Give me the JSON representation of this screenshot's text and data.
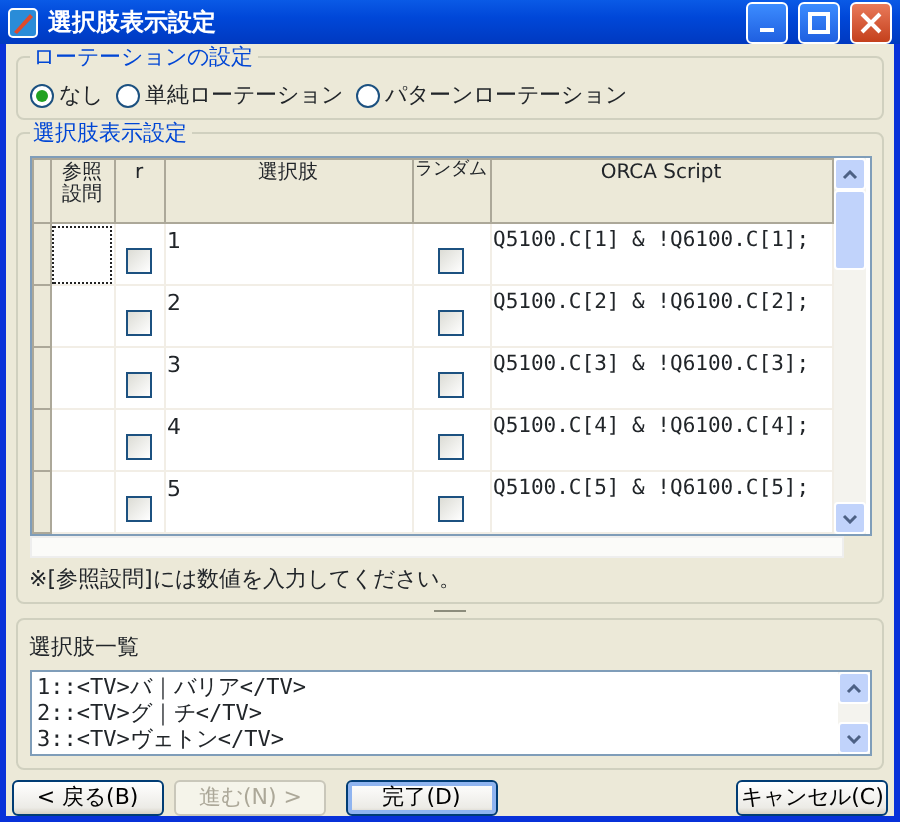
{
  "window": {
    "title": "選択肢表示設定"
  },
  "rotation": {
    "label": "ローテーションの設定",
    "options": [
      {
        "label": "なし",
        "selected": true
      },
      {
        "label": "単純ローテーション",
        "selected": false
      },
      {
        "label": "パターンローテーション",
        "selected": false
      }
    ]
  },
  "choices": {
    "label": "選択肢表示設定",
    "columns": [
      "参照設問",
      "r",
      "選択肢",
      "ランダム",
      "ORCA Script"
    ],
    "rows": [
      {
        "reference": "",
        "focused": true,
        "r_checked": false,
        "text": "1",
        "random_checked": false,
        "script": "Q5100.C[1] & !Q6100.C[1];"
      },
      {
        "reference": "",
        "focused": false,
        "r_checked": false,
        "text": "2",
        "random_checked": false,
        "script": "Q5100.C[2] & !Q6100.C[2];"
      },
      {
        "reference": "",
        "focused": false,
        "r_checked": false,
        "text": "3",
        "random_checked": false,
        "script": "Q5100.C[3] & !Q6100.C[3];"
      },
      {
        "reference": "",
        "focused": false,
        "r_checked": false,
        "text": "4",
        "random_checked": false,
        "script": "Q5100.C[4] & !Q6100.C[4];"
      },
      {
        "reference": "",
        "focused": false,
        "r_checked": false,
        "text": "5",
        "random_checked": false,
        "script": "Q5100.C[5] & !Q6100.C[5];"
      }
    ],
    "note": "※[参照設問]には数値を入力してください。"
  },
  "list": {
    "label": "選択肢一覧",
    "lines": [
      "1::<TV>バ｜バリア</TV>",
      "2::<TV>グ｜チ</TV>",
      "3::<TV>ヴェトン</TV>"
    ]
  },
  "buttons": [
    {
      "label": "< 戻る(B)",
      "disabled": false,
      "default": false
    },
    {
      "label": "進む(N) >",
      "disabled": true,
      "default": false
    },
    {
      "label": "完了(D)",
      "disabled": false,
      "default": true
    },
    {
      "label": "キャンセル(C)",
      "disabled": false,
      "default": false
    }
  ]
}
